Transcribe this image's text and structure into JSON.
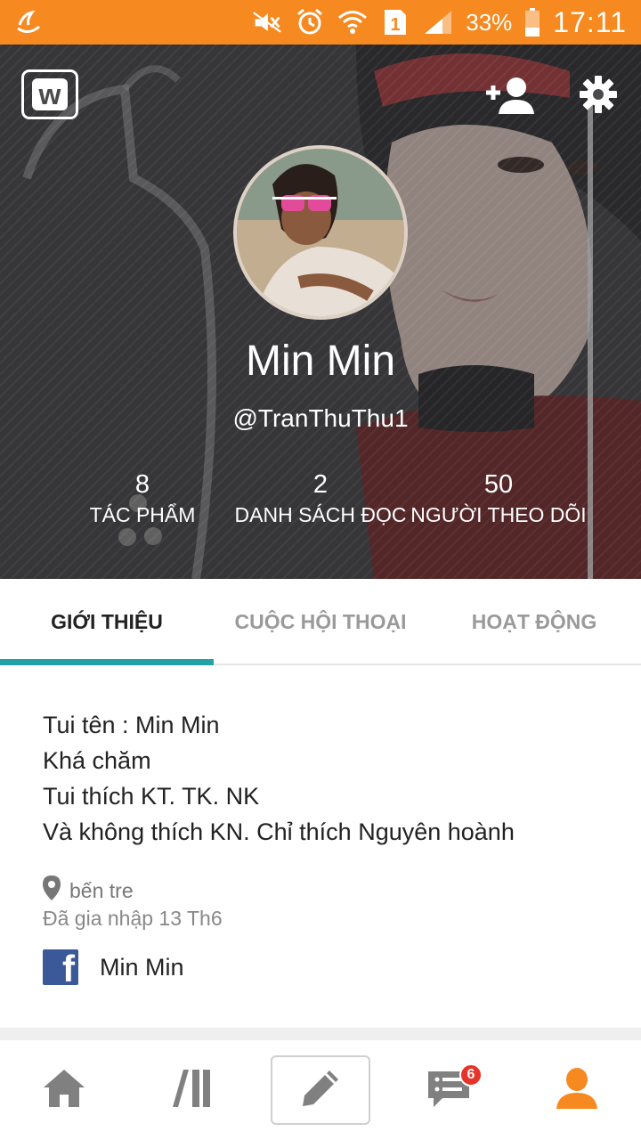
{
  "status_bar": {
    "battery_percent": "33%",
    "time": "17:11",
    "sim_slot": "1",
    "icons": [
      "app-notification-icon",
      "mute-icon",
      "alarm-icon",
      "wifi-icon",
      "sim-icon",
      "signal-icon",
      "battery-icon"
    ]
  },
  "header": {
    "logo_letter": "w",
    "display_name": "Min Min",
    "username": "@TranThuThu1",
    "icons": [
      "add-user-icon",
      "gear-icon"
    ]
  },
  "stats": [
    {
      "value": "8",
      "label": "TÁC PHẨM"
    },
    {
      "value": "2",
      "label": "DANH SÁCH ĐỌC"
    },
    {
      "value": "50",
      "label": "NGƯỜI THEO DÕI"
    }
  ],
  "tabs": [
    {
      "label": "GIỚI THIỆU",
      "active": true
    },
    {
      "label": "CUỘC HỘI THOẠI",
      "active": false
    },
    {
      "label": "HOẠT ĐỘNG",
      "active": false
    }
  ],
  "about": {
    "bio": [
      "Tui tên : Min Min",
      "Khá chăm",
      "Tui thích KT. TK. NK",
      "Và không thích KN. Chỉ thích Nguyên hoành"
    ],
    "location": "bến tre",
    "joined": "Đã gia nhập 13 Th6",
    "facebook_name": "Min Min",
    "facebook_glyph": "f"
  },
  "bottom_nav": {
    "items": [
      "home-icon",
      "library-icon",
      "pencil-icon",
      "messages-icon",
      "profile-icon"
    ],
    "messages_badge": "6",
    "accent_color": "#f6891f"
  },
  "colors": {
    "status_bar": "#f6891f",
    "tab_indicator": "#22a2a5",
    "facebook": "#3b5998",
    "badge": "#e8332a"
  }
}
